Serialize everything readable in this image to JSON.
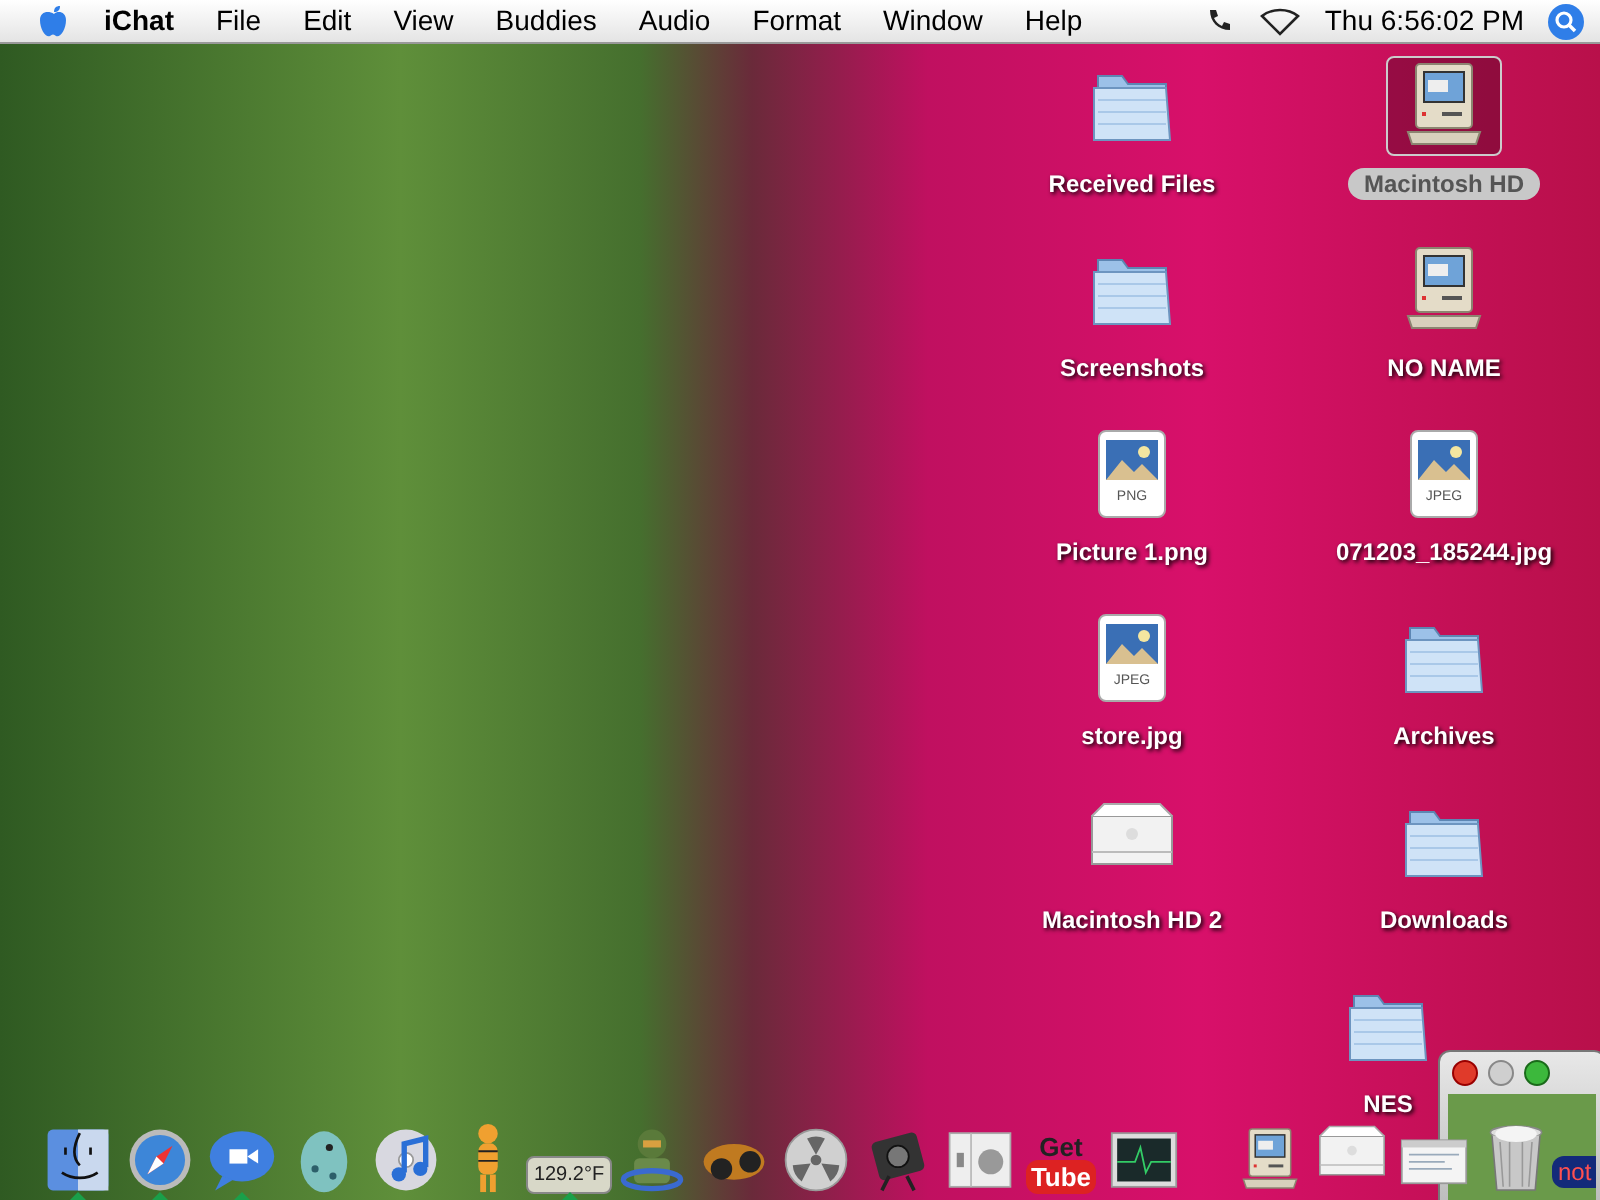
{
  "menu_bar": {
    "items": [
      {
        "label": "iChat",
        "kind": "app"
      },
      {
        "label": "File",
        "kind": "menu"
      },
      {
        "label": "Edit",
        "kind": "menu"
      },
      {
        "label": "View",
        "kind": "menu"
      },
      {
        "label": "Buddies",
        "kind": "menu"
      },
      {
        "label": "Audio",
        "kind": "menu"
      },
      {
        "label": "Format",
        "kind": "menu"
      },
      {
        "label": "Window",
        "kind": "menu"
      },
      {
        "label": "Help",
        "kind": "menu"
      }
    ],
    "clock": "Thu 6:56:02 PM"
  },
  "desktop_icon_columns": [
    [
      {
        "name": "Received Files",
        "kind": "folder",
        "selected": false
      },
      {
        "name": "Screenshots",
        "kind": "folder",
        "selected": false
      },
      {
        "name": "Picture 1.png",
        "kind": "file",
        "type_label": "PNG",
        "selected": false
      },
      {
        "name": "store.jpg",
        "kind": "file",
        "type_label": "JPEG",
        "selected": false
      },
      {
        "name": "Macintosh HD 2",
        "kind": "drive",
        "selected": false
      }
    ],
    [
      {
        "name": "Macintosh HD",
        "kind": "computer",
        "selected": true
      },
      {
        "name": "NO NAME",
        "kind": "computer",
        "selected": false
      },
      {
        "name": "071203_185244.jpg",
        "kind": "file",
        "type_label": "JPEG",
        "selected": false
      },
      {
        "name": "Archives",
        "kind": "folder",
        "selected": false
      },
      {
        "name": "Downloads",
        "kind": "folder",
        "selected": false
      },
      {
        "name": "NES",
        "kind": "folder",
        "selected": false
      }
    ]
  ],
  "dock": [
    {
      "kind": "finder",
      "running": true
    },
    {
      "kind": "compass",
      "running": true
    },
    {
      "kind": "chat",
      "running": true
    },
    {
      "kind": "egg",
      "running": false
    },
    {
      "kind": "music",
      "running": false
    },
    {
      "kind": "tiger",
      "running": false
    },
    {
      "kind": "widget",
      "text": "129.2°F",
      "running": true
    },
    {
      "kind": "soldier",
      "running": false
    },
    {
      "kind": "car",
      "running": false
    },
    {
      "kind": "radiation",
      "running": false
    },
    {
      "kind": "camera",
      "running": false
    },
    {
      "kind": "switch",
      "running": false
    },
    {
      "kind": "logo",
      "text_top": "Get",
      "text_bottom": "Tube",
      "running": false
    },
    {
      "kind": "monitor",
      "running": false
    },
    {
      "kind": "gap"
    },
    {
      "kind": "computer",
      "running": false
    },
    {
      "kind": "drive",
      "running": false
    },
    {
      "kind": "screenshot",
      "running": false
    },
    {
      "kind": "trash",
      "running": false
    }
  ],
  "window": {
    "bubble_text": "not"
  }
}
